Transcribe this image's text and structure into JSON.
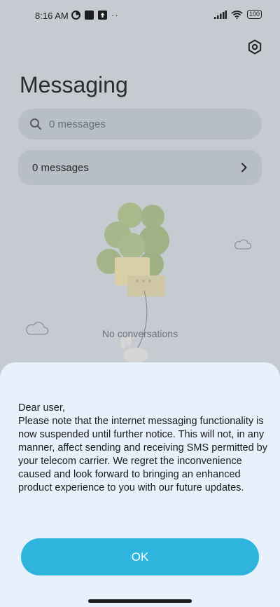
{
  "status": {
    "time": "8:16 AM",
    "battery": "100"
  },
  "header": {
    "title": "Messaging"
  },
  "search": {
    "placeholder": "0 messages"
  },
  "messages_row": {
    "label": "0 messages"
  },
  "empty_state": {
    "text": "No conversations"
  },
  "dialog": {
    "message": "Dear user,\nPlease note that the internet messaging functionality is now suspended until further notice. This will not, in any manner, affect sending and receiving SMS permitted by your telecom carrier. We regret the inconvenience caused and look forward to bringing an enhanced product experience to you with our future updates.",
    "ok_label": "OK",
    "ok_color": "#2fb4dd",
    "background": "#e6f1fb"
  }
}
